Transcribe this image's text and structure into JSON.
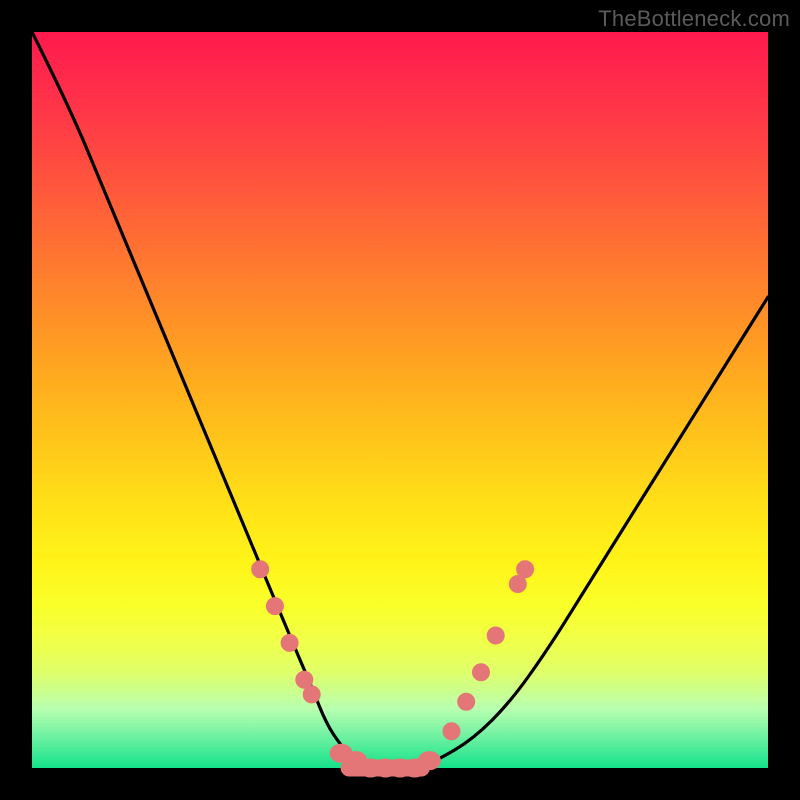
{
  "watermark": "TheBottleneck.com",
  "colors": {
    "frame_bg": "#000000",
    "curve": "#000000",
    "marker": "#e57677",
    "gradient_top": "#ff1a4d",
    "gradient_bottom": "#14e28a"
  },
  "chart_data": {
    "type": "line",
    "title": "",
    "xlabel": "",
    "ylabel": "",
    "xlim": [
      0,
      100
    ],
    "ylim": [
      0,
      100
    ],
    "x": [
      0,
      5,
      10,
      15,
      20,
      25,
      30,
      35,
      38,
      40,
      42,
      44,
      46,
      48,
      50,
      52,
      55,
      60,
      65,
      70,
      75,
      80,
      85,
      90,
      95,
      100
    ],
    "values": [
      100,
      90,
      78,
      66,
      54,
      42,
      30,
      18,
      11,
      6,
      3,
      1,
      0,
      0,
      0,
      0,
      1,
      4,
      9,
      16,
      24,
      32,
      40,
      48,
      56,
      64
    ],
    "series": [
      {
        "name": "bottleneck-curve",
        "x": [
          0,
          5,
          10,
          15,
          20,
          25,
          30,
          35,
          38,
          40,
          42,
          44,
          46,
          48,
          50,
          52,
          55,
          60,
          65,
          70,
          75,
          80,
          85,
          90,
          95,
          100
        ],
        "values": [
          100,
          90,
          78,
          66,
          54,
          42,
          30,
          18,
          11,
          6,
          3,
          1,
          0,
          0,
          0,
          0,
          1,
          4,
          9,
          16,
          24,
          32,
          40,
          48,
          56,
          64
        ]
      }
    ],
    "markers": {
      "left_arm": [
        {
          "x": 31,
          "y": 27
        },
        {
          "x": 33,
          "y": 22
        },
        {
          "x": 35,
          "y": 17
        },
        {
          "x": 37,
          "y": 12
        },
        {
          "x": 38,
          "y": 10
        }
      ],
      "valley": [
        {
          "x": 42,
          "y": 2
        },
        {
          "x": 44,
          "y": 1
        },
        {
          "x": 46,
          "y": 0
        },
        {
          "x": 48,
          "y": 0
        },
        {
          "x": 50,
          "y": 0
        },
        {
          "x": 52,
          "y": 0
        },
        {
          "x": 54,
          "y": 1
        }
      ],
      "right_arm": [
        {
          "x": 57,
          "y": 5
        },
        {
          "x": 59,
          "y": 9
        },
        {
          "x": 61,
          "y": 13
        },
        {
          "x": 63,
          "y": 18
        },
        {
          "x": 66,
          "y": 25
        },
        {
          "x": 67,
          "y": 27
        }
      ]
    }
  }
}
